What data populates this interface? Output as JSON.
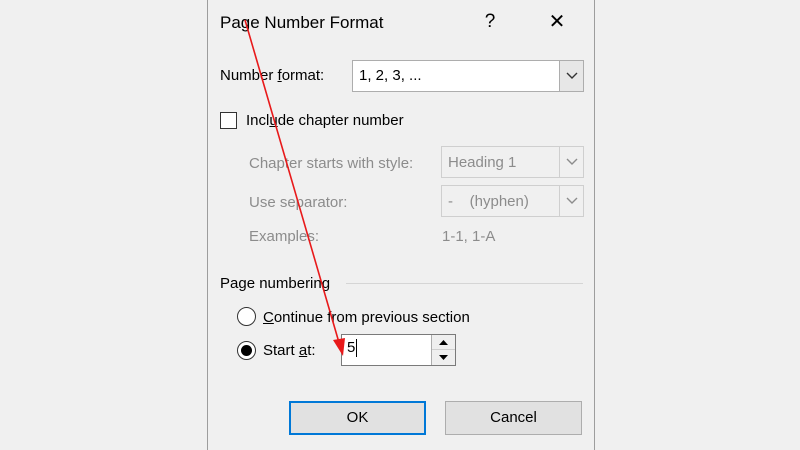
{
  "dialog": {
    "title": "Page Number Format",
    "help_label": "?",
    "close_label": "✕"
  },
  "number_format": {
    "label": "Number format:",
    "value": "1, 2, 3, ..."
  },
  "include_chapter": {
    "label": "Include chapter number",
    "checked": false
  },
  "chapter_style": {
    "label": "Chapter starts with style:",
    "value": "Heading 1"
  },
  "separator": {
    "label": "Use separator:",
    "value": "-    (hyphen)"
  },
  "examples": {
    "label": "Examples:",
    "value": "1-1, 1-A"
  },
  "page_numbering": {
    "heading": "Page numbering",
    "continue_label": "Continue from previous section",
    "start_at_label": "Start at:",
    "start_at_value": "5",
    "selected": "start_at"
  },
  "buttons": {
    "ok": "OK",
    "cancel": "Cancel"
  },
  "annotation": {
    "arrow_color": "#e8191a"
  }
}
